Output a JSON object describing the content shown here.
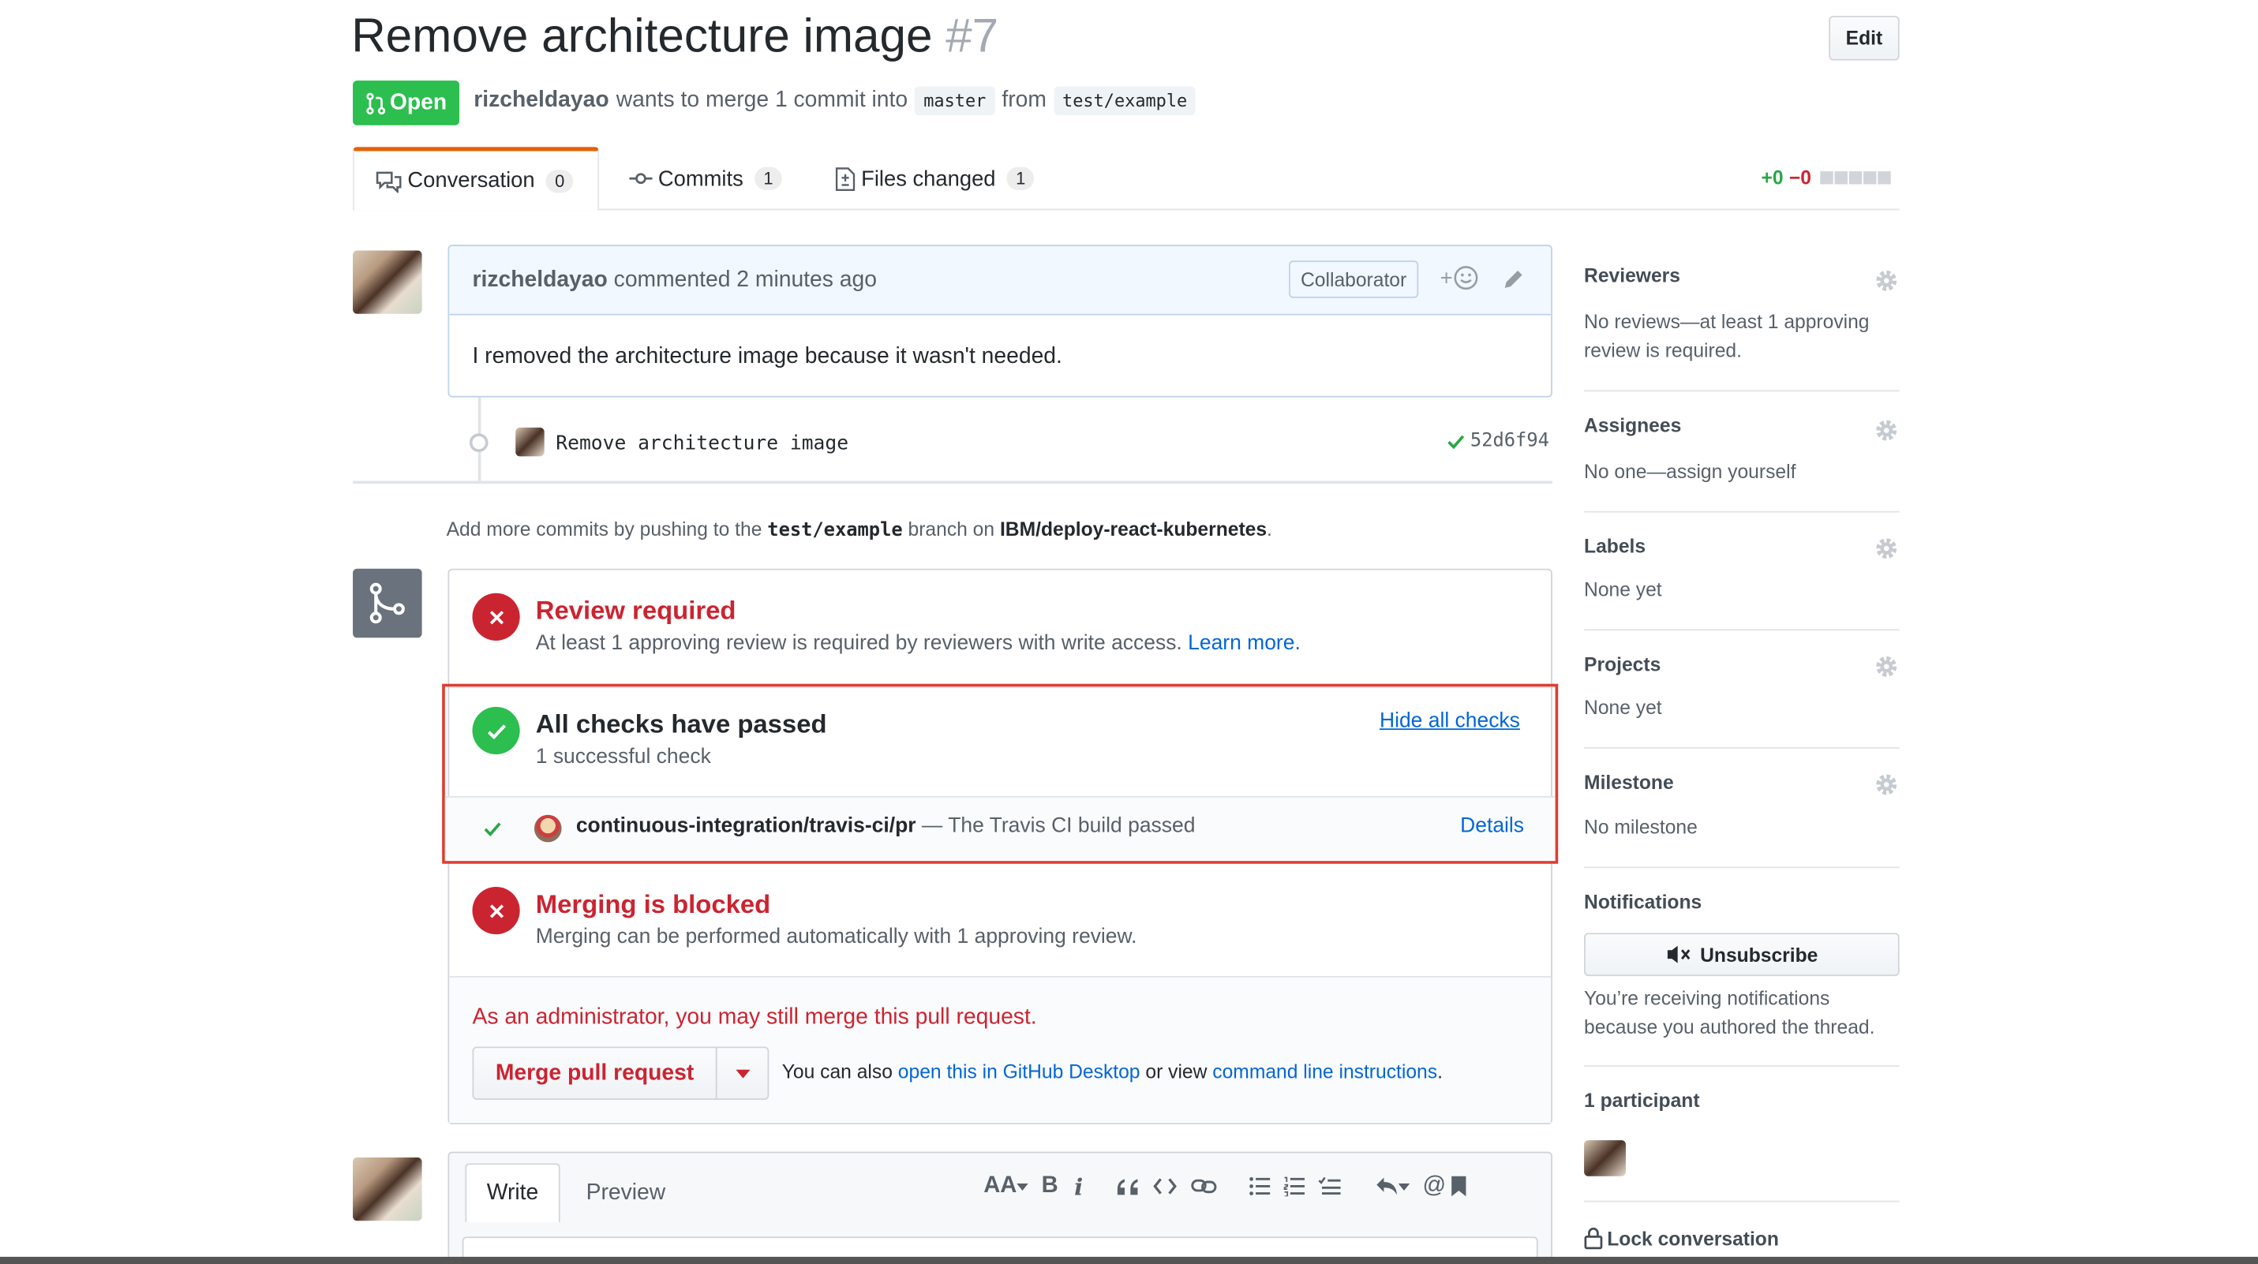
{
  "pr": {
    "title": "Remove architecture image",
    "number": "#7",
    "edit": "Edit",
    "state": "Open",
    "author": "rizcheldayao",
    "merge_text": "wants to merge 1 commit into",
    "base": "master",
    "from": "from",
    "head": "test/example"
  },
  "tabs": [
    {
      "label": "Conversation",
      "count": "0"
    },
    {
      "label": "Commits",
      "count": "1"
    },
    {
      "label": "Files changed",
      "count": "1"
    }
  ],
  "diffstat": {
    "add": "+0",
    "del": "−0"
  },
  "comment": {
    "author": "rizcheldayao",
    "time": "commented 2 minutes ago",
    "badge": "Collaborator",
    "react": "+",
    "body": "I removed the architecture image because it wasn't needed."
  },
  "commit": {
    "message": "Remove architecture image",
    "sha": "52d6f94"
  },
  "push_hint": {
    "pre": "Add more commits by pushing to the",
    "branch": "test/example",
    "mid": "branch on",
    "repo": "IBM/deploy-react-kubernetes",
    "end": "."
  },
  "review": {
    "title": "Review required",
    "desc": "At least 1 approving review is required by reviewers with write access.",
    "learn": "Learn more."
  },
  "checks": {
    "title": "All checks have passed",
    "sub": "1 successful check",
    "hide": "Hide all checks",
    "name": "continuous-integration/travis-ci/pr",
    "desc": "— The Travis CI build passed",
    "details": "Details"
  },
  "blocked": {
    "title": "Merging is blocked",
    "desc": "Merging can be performed automatically with 1 approving review."
  },
  "admin": {
    "text": "As an administrator, you may still merge this pull request.",
    "merge_btn": "Merge pull request",
    "also": "You can also",
    "desktop": "open this in GitHub Desktop",
    "or_view": "or view",
    "cli": "command line instructions",
    "end": "."
  },
  "editor": {
    "write": "Write",
    "preview": "Preview",
    "heading": "AA",
    "bold": "B",
    "italic": "i",
    "mention": "@"
  },
  "sidebar": {
    "reviewers": {
      "h": "Reviewers",
      "t1": "No reviews—at least 1 approving",
      "t2": "review is required."
    },
    "assignees": {
      "h": "Assignees",
      "t": "No one—assign yourself"
    },
    "labels": {
      "h": "Labels",
      "t": "None yet"
    },
    "projects": {
      "h": "Projects",
      "t": "None yet"
    },
    "milestone": {
      "h": "Milestone",
      "t": "No milestone"
    },
    "notifications": {
      "h": "Notifications",
      "btn": "Unsubscribe",
      "t1": "You’re receiving notifications",
      "t2": "because you authored the thread."
    },
    "participants": {
      "h": "1 participant"
    },
    "lock": {
      "h": "Lock conversation"
    }
  },
  "colors": {
    "green": "#2cbe4e",
    "red": "#cb2431",
    "blue": "#0366d6"
  }
}
